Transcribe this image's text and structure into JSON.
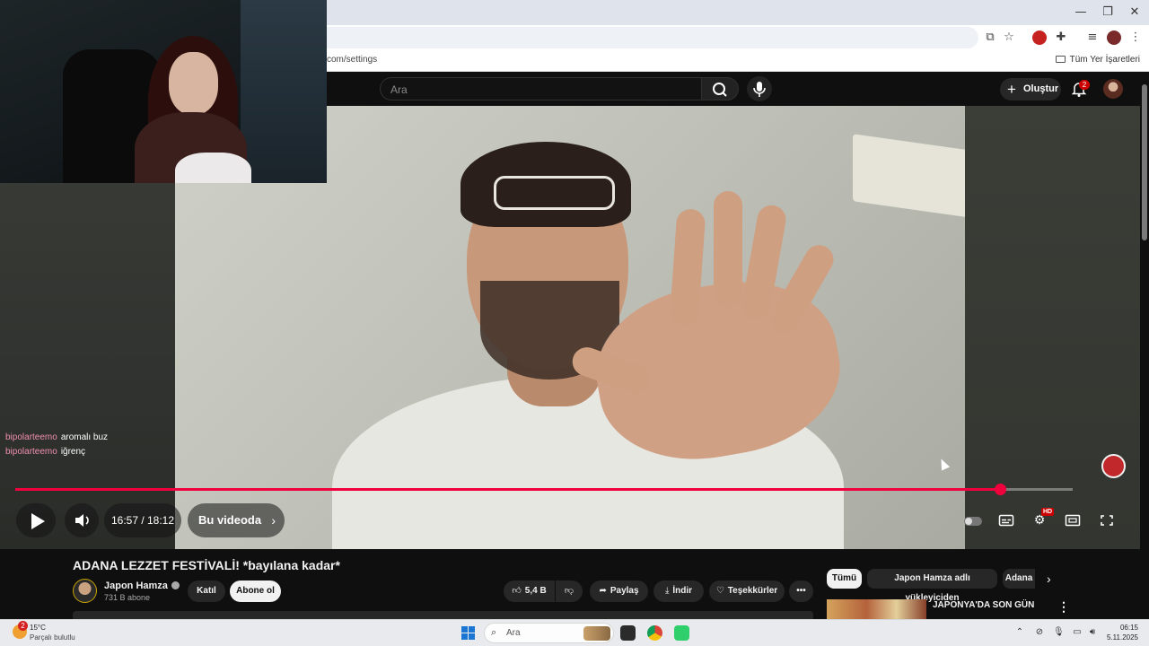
{
  "browser": {
    "url_fragment": "com/settings",
    "bookmarks_all_label": "Tüm Yer İşaretleri",
    "window_controls": {
      "minimize": "—",
      "maximize": "❐",
      "close": "✕"
    }
  },
  "youtube_header": {
    "search_placeholder": "Ara",
    "create_label": "Oluştur",
    "notification_count": "2"
  },
  "stream_overlay": {
    "chat": [
      {
        "user": "bipolarteemo",
        "message": "aromalı buz"
      },
      {
        "user": "bipolarteemo",
        "message": "iğrenç"
      }
    ]
  },
  "player": {
    "time_display": "16:57 / 18:12",
    "chapter_label": "Bu videoda",
    "progress_fraction": 0.9313,
    "hd_badge": "HD"
  },
  "video": {
    "title": "ADANA LEZZET FESTİVALİ! *bayılana kadar*",
    "channel_name": "Japon Hamza",
    "subscribers": "731 B abone",
    "join_label": "Katıl",
    "subscribe_label": "Abone ol",
    "like_count": "5,4 B",
    "share_label": "Paylaş",
    "download_label": "İndir",
    "thanks_label": "Teşekkürler",
    "more_label": "•••"
  },
  "recommendations": {
    "chips": [
      "Tümü",
      "Japon Hamza adlı yükleyiciden",
      "Adana"
    ],
    "first_title": "JAPONYA'DA SON GÜN"
  },
  "taskbar": {
    "weather_badge": "2",
    "temperature": "15°C",
    "weather_desc": "Parçalı bulutlu",
    "search_label": "Ara",
    "time": "06:15",
    "date": "5.11.2025"
  },
  "colors": {
    "progress": "#f0003c",
    "chat_username": "#ef8fb0",
    "page_bg": "#0f0f0f"
  }
}
